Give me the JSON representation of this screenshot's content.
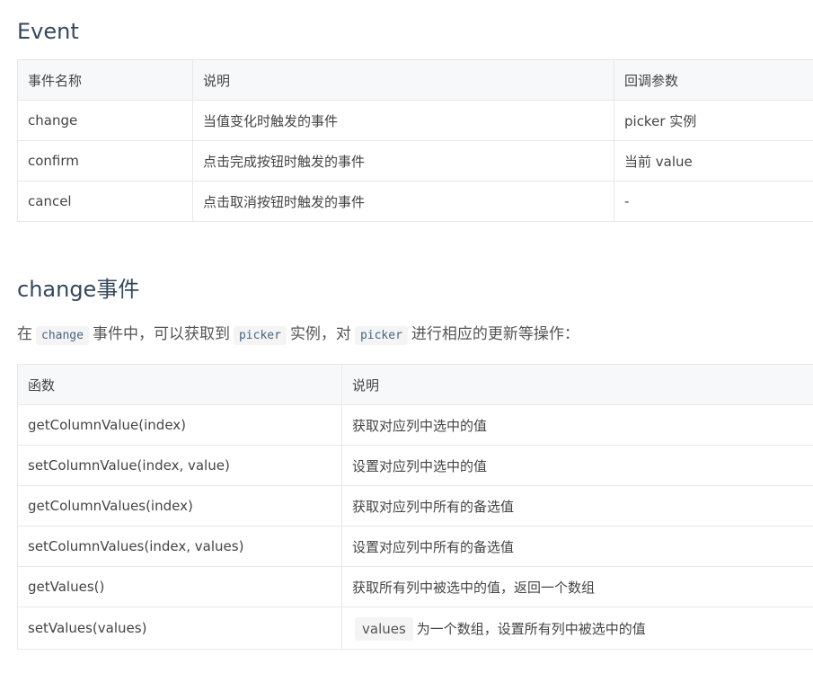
{
  "event_section": {
    "title": "Event",
    "headers": [
      "事件名称",
      "说明",
      "回调参数"
    ],
    "rows": [
      [
        "change",
        "当值变化时触发的事件",
        "picker 实例"
      ],
      [
        "confirm",
        "点击完成按钮时触发的事件",
        "当前 value"
      ],
      [
        "cancel",
        "点击取消按钮时触发的事件",
        "-"
      ]
    ]
  },
  "change_section": {
    "title": "change事件",
    "desc": {
      "t1": "在",
      "c1": "change",
      "t2": "事件中，可以获取到",
      "c2": "picker",
      "t3": "实例，对",
      "c3": "picker",
      "t4": "进行相应的更新等操作："
    },
    "headers": [
      "函数",
      "说明"
    ],
    "rows": [
      [
        "getColumnValue(index)",
        "获取对应列中选中的值"
      ],
      [
        "setColumnValue(index, value)",
        "设置对应列中选中的值"
      ],
      [
        "getColumnValues(index)",
        "获取对应列中所有的备选值"
      ],
      [
        "setColumnValues(index, values)",
        "设置对应列中所有的备选值"
      ],
      [
        "getValues()",
        "获取所有列中被选中的值，返回一个数组"
      ]
    ],
    "last_row": {
      "method": "setValues(values)",
      "code": "values",
      "text": "为一个数组，设置所有列中被选中的值"
    }
  }
}
